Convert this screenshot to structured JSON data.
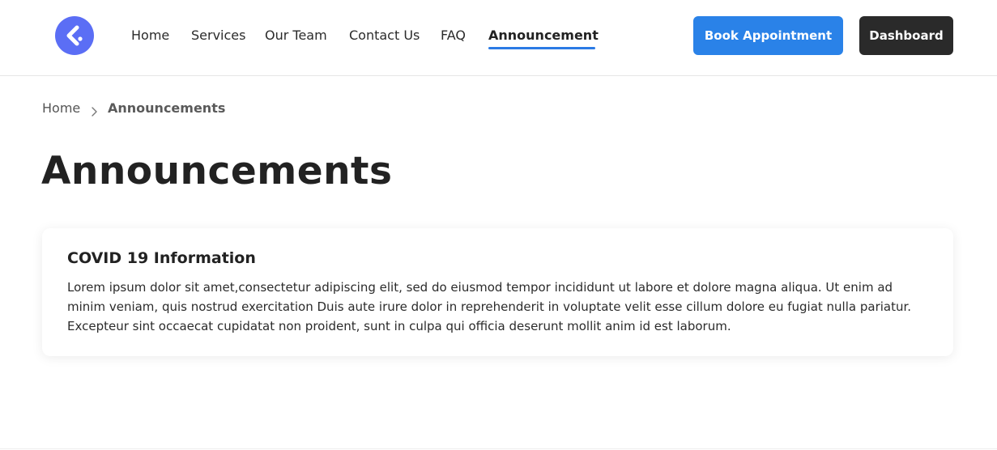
{
  "header": {
    "nav": [
      {
        "label": "Home",
        "active": false
      },
      {
        "label": "Services",
        "active": false
      },
      {
        "label": "Our Team",
        "active": false
      },
      {
        "label": "Contact Us",
        "active": false
      },
      {
        "label": "FAQ",
        "active": false
      },
      {
        "label": "Announcement",
        "active": true
      }
    ],
    "book_label": "Book Appointment",
    "dashboard_label": "Dashboard"
  },
  "breadcrumb": {
    "home": "Home",
    "current": "Announcements"
  },
  "page": {
    "title": "Announcements"
  },
  "announcements": [
    {
      "title": "COVID 19 Information",
      "body": "Lorem ipsum dolor sit amet,consectetur adipiscing elit, sed do eiusmod tempor incididunt ut labore et dolore magna aliqua. Ut enim ad minim veniam, quis nostrud exercitation Duis aute irure dolor in reprehenderit in voluptate velit esse cillum dolore eu fugiat nulla pariatur. Excepteur sint occaecat cupidatat non proident, sunt in culpa qui officia deserunt mollit anim id est laborum."
    }
  ],
  "icons": {
    "logo": "logo-icon",
    "breadcrumb_separator": "chevron-right-icon"
  },
  "colors": {
    "brand": "#5b6ef5",
    "primary_button": "#2a82e8",
    "dark_button": "#2a2a2a",
    "active_underline": "#2b7be5"
  }
}
